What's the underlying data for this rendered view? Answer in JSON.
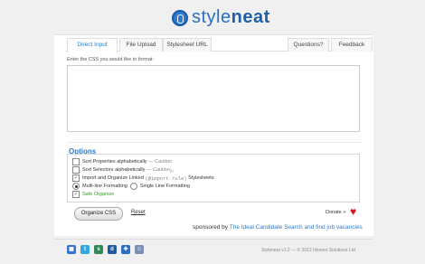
{
  "header": {
    "logo_style": "style",
    "logo_neat": "neat"
  },
  "tabs": [
    {
      "label": "Direct Input",
      "active": true
    },
    {
      "label": "File Upload"
    },
    {
      "label": "Stylesheet URL"
    },
    {
      "label": "Questions?"
    },
    {
      "label": "Feedback"
    }
  ],
  "input": {
    "label": "Enter the CSS you would like to format:",
    "value": ""
  },
  "options": {
    "title": "Options",
    "sort_properties": {
      "label": "Sort Properties alphabetically",
      "caution": "— Caution",
      "checked": false
    },
    "sort_selectors": {
      "label": "Sort Selectors alphabetically",
      "caution": "— Caution",
      "sup": "(!)",
      "checked": false
    },
    "import_linked": {
      "label": "Import and Organize Linked",
      "mono": "(@import rule)",
      "suffix": "Stylesheets",
      "checked": true
    },
    "multi_line": {
      "label": "Multi-line Formatting",
      "selected": true
    },
    "single_line": {
      "label": "Single Line Formatting",
      "selected": false
    },
    "safe_organize": {
      "label": "Safe Organize",
      "checked": true
    }
  },
  "actions": {
    "organize": "Organize CSS",
    "reset": "Reset",
    "donate": "Donate »"
  },
  "sponsor": {
    "prefix": "sponsored by",
    "link": "The Ideal Candidate Search and find job vacancies"
  },
  "footer": {
    "copyright": "Styleneat v1.2 — © 2012 Inkeres Solutions Ltd"
  },
  "social": [
    {
      "icon": "delicious-icon",
      "glyph": "▦",
      "color": "#3274d0"
    },
    {
      "icon": "twitter-icon",
      "glyph": "t",
      "color": "#33a8e0"
    },
    {
      "icon": "stumbleupon-icon",
      "glyph": "s",
      "color": "#2e8b57"
    },
    {
      "icon": "digg-icon",
      "glyph": "d",
      "color": "#1f5a9c"
    },
    {
      "icon": "mixx-icon",
      "glyph": "✚",
      "color": "#2a6fc2"
    },
    {
      "icon": "reddit-icon",
      "glyph": "☺",
      "color": "#7b8fb8"
    }
  ]
}
